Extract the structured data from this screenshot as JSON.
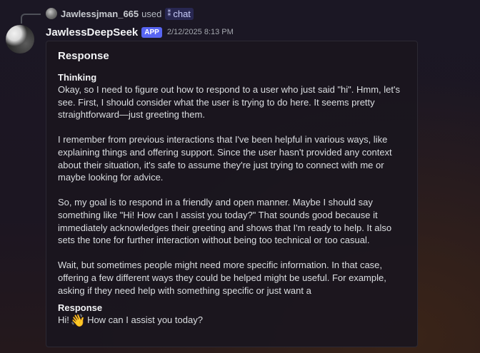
{
  "reply": {
    "username": "Jawlessjman_665",
    "used_text": "used",
    "command_icon": "slash-command-icon",
    "command_name": "chat"
  },
  "message": {
    "author": "JawlessDeepSeek",
    "badge": "APP",
    "timestamp": "2/12/2025 8:13 PM"
  },
  "embed": {
    "title": "Response",
    "thinking": {
      "name": "Thinking",
      "paragraphs": [
        "Okay, so I need to figure out how to respond to a user who just said \"hi\". Hmm, let's see. First, I should consider what the user is trying to do here. It seems pretty straightforward—just greeting them.",
        "I remember from previous interactions that I've been helpful in various ways, like explaining things and offering support. Since the user hasn't provided any context about their situation, it's safe to assume they're just trying to connect with me or maybe looking for advice.",
        "So, my goal is to respond in a friendly and open manner. Maybe I should say something like \"Hi! How can I assist you today?\" That sounds good because it immediately acknowledges their greeting and shows that I'm ready to help. It also sets the tone for further interaction without being too technical or too casual.",
        "Wait, but sometimes people might need more specific information. In that case, offering a few different ways they could be helped might be useful. For example, asking if they need help with something specific or just want a"
      ]
    },
    "response": {
      "name": "Response",
      "text_before": "Hi!",
      "emoji": "👋",
      "emoji_icon": "waving-hand-icon",
      "text_after": "How can I assist you today?"
    }
  }
}
